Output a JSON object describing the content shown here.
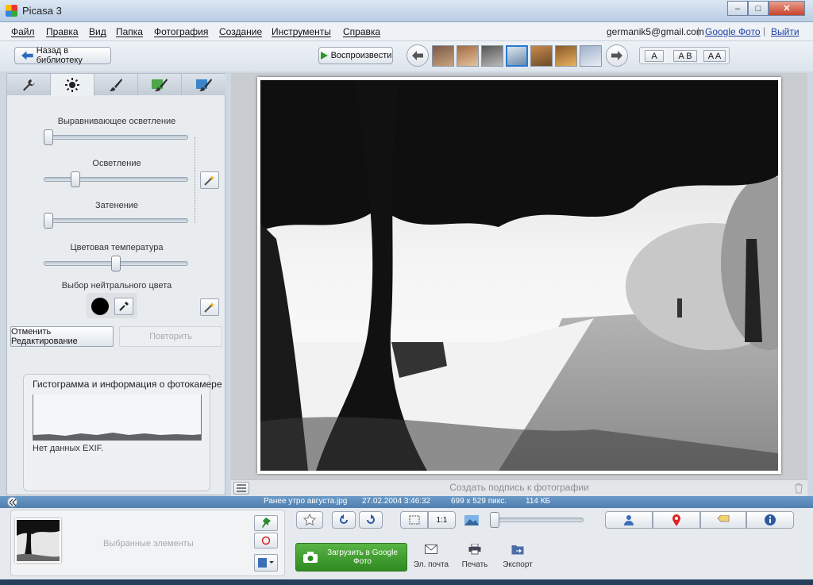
{
  "window": {
    "title": "Picasa 3",
    "btn_min": "–",
    "btn_max": "□",
    "btn_close": "✕"
  },
  "menu": [
    "Файл",
    "Правка",
    "Вид",
    "Папка",
    "Фотография",
    "Создание",
    "Инструменты",
    "Справка"
  ],
  "account": {
    "email": "germanik5@gmail.com",
    "photos_link": "Google Фото",
    "logout_link": "Выйти",
    "sep": "|"
  },
  "toolbar": {
    "back_label": "Назад в библиотеку",
    "play_label": "Воспроизвести",
    "layout_a": "A",
    "layout_ab": "A B",
    "layout_aa": "A A",
    "thumb_count": 7,
    "selected_thumb": 4
  },
  "edit": {
    "fill_light_label": "Выравнивающее осветление",
    "highlights_label": "Осветление",
    "shadows_label": "Затенение",
    "color_temp_label": "Цветовая температура",
    "neutral_label": "Выбор нейтрального цвета",
    "undo_label": "Отменить Редактирование",
    "redo_label": "Повторить",
    "fill_light_value": 0.0,
    "highlights_value": 0.2,
    "shadows_value": 0.0,
    "color_temp_value": 0.5
  },
  "histogram": {
    "title": "Гистограмма и информация о фотокамере",
    "exif": "Нет данных EXIF."
  },
  "caption": {
    "placeholder": "Создать подпись к фотографии"
  },
  "status": {
    "filename": "Ранее утро августа.jpg",
    "date": "27.02.2004 3:46:32",
    "dimensions": "699 x 529 пикс.",
    "size": "114 КБ"
  },
  "tray": {
    "selected_label": "Выбранные элементы"
  },
  "actions": {
    "upload": "Загрузить в Google Фото",
    "email": "Эл. почта",
    "print": "Печать",
    "export": "Экспорт"
  },
  "zoom": {
    "fit_label": "1:1",
    "level": 0.0
  },
  "colors": {
    "accent": "#2a78d2",
    "status_bar": "#5886b6",
    "upload_green": "#3f9e2e"
  }
}
